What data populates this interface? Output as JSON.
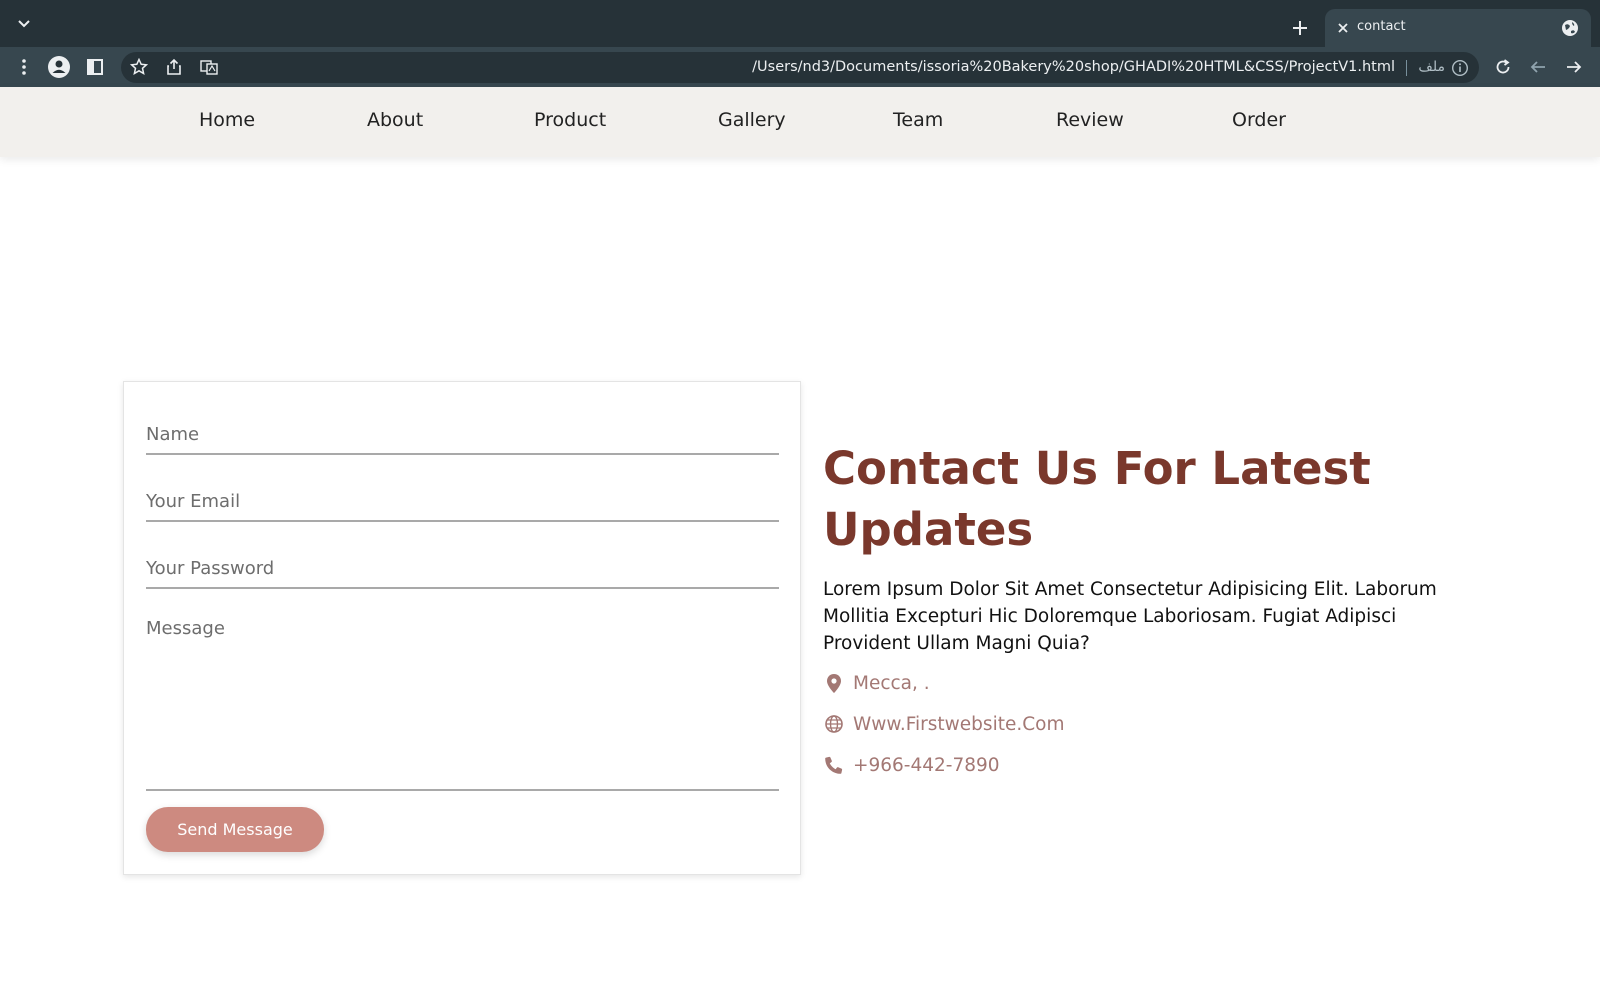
{
  "browser": {
    "tab": {
      "title": "contact"
    },
    "address_bar": {
      "url": "/Users/nd3/Documents/issoria%20Bakery%20shop/GHADI%20HTML&CSS/ProjectV1.html",
      "scheme_label": "ملف"
    }
  },
  "nav": {
    "items": [
      "Home",
      "About",
      "Product",
      "Gallery",
      "Team",
      "Review",
      "Order"
    ]
  },
  "form": {
    "name_placeholder": "Name",
    "email_placeholder": "Your Email",
    "password_placeholder": "Your Password",
    "message_placeholder": "Message",
    "submit_label": "Send Message"
  },
  "info": {
    "title": "Contact Us For Latest Updates",
    "text": "Lorem Ipsum Dolor Sit Amet Consectetur Adipisicing Elit. Laborum Mollitia Excepturi Hic Doloremque Laboriosam. Fugiat Adipisci Provident Ullam Magni Quia?",
    "location": "Mecca, .",
    "website": "Www.Firstwebsite.Com",
    "phone": "+966-442-7890"
  },
  "icons": {
    "location": "map-marker-icon",
    "website": "globe-icon",
    "phone": "phone-icon"
  },
  "colors": {
    "chrome_dark": "#263238",
    "chrome_toolbar": "#37474f",
    "nav_bg": "#f2f0ed",
    "heading": "#7a382c",
    "button": "#cd8a80",
    "contact_text": "#a37874"
  }
}
